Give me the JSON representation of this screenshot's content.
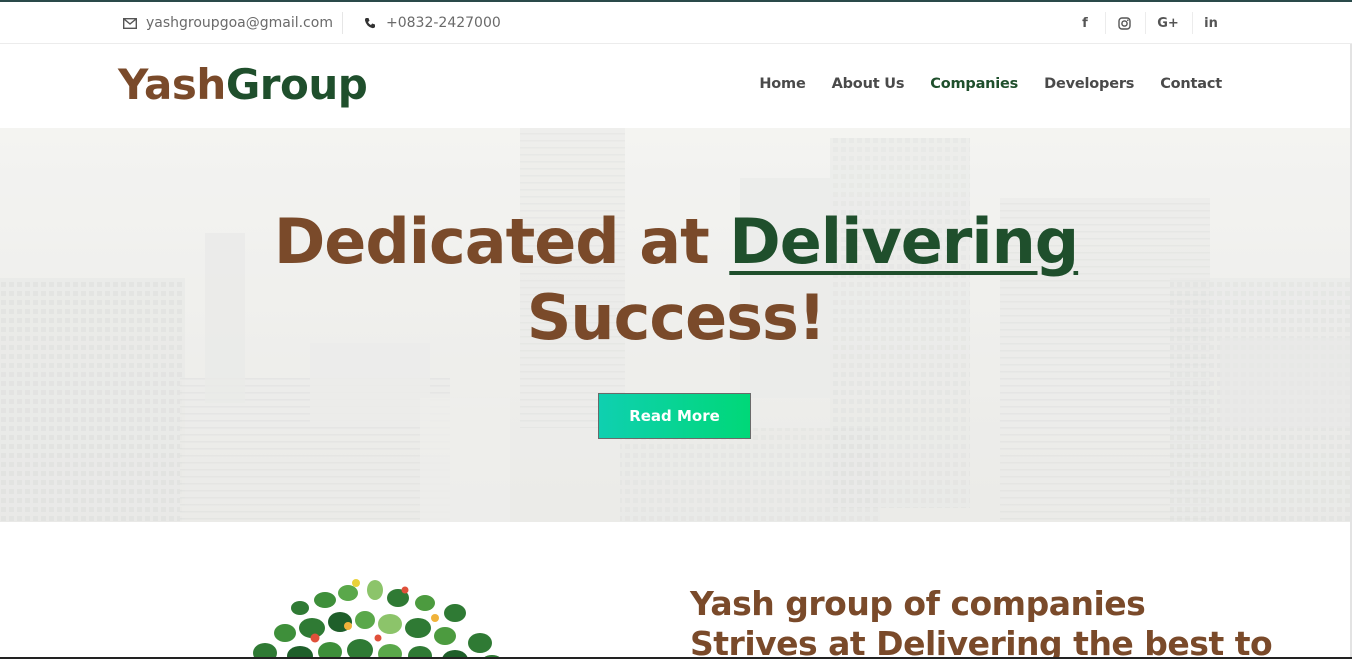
{
  "topbar": {
    "email": "yashgroupgoa@gmail.com",
    "phone": "+0832-2427000",
    "email_icon": "envelope-icon",
    "phone_icon": "phone-icon",
    "social": [
      {
        "name": "facebook-icon",
        "glyph": "f"
      },
      {
        "name": "instagram-icon",
        "glyph": "◎"
      },
      {
        "name": "google-plus-icon",
        "glyph": "G+"
      },
      {
        "name": "linkedin-icon",
        "glyph": "in"
      }
    ]
  },
  "header": {
    "logo_part1": "Yash",
    "logo_part2": "Group",
    "nav": {
      "home": "Home",
      "about": "About Us",
      "companies": "Companies",
      "developers": "Developers",
      "contact": "Contact"
    }
  },
  "hero": {
    "title_part1": "Dedicated at ",
    "title_highlight": "Delivering",
    "title_part2": "Success!",
    "button": "Read More"
  },
  "about": {
    "heading_line1": "Yash group of companies",
    "heading_line2": "Strives at Delivering the best to"
  },
  "colors": {
    "brown": "#7a4a2a",
    "green": "#1f4f2c",
    "button_start": "#0fd0b0",
    "button_end": "#00d878"
  }
}
